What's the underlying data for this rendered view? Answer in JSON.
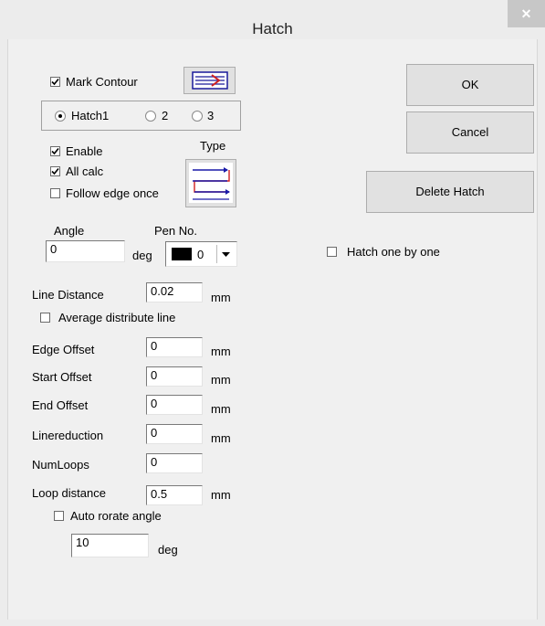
{
  "window": {
    "title": "Hatch",
    "close_glyph": "✕"
  },
  "contour": {
    "mark_label": "Mark Contour",
    "mark_checked": true
  },
  "hatch_select": {
    "options": [
      "Hatch1",
      "2",
      "3"
    ],
    "selected": "Hatch1"
  },
  "hatch": {
    "enable_label": "Enable",
    "enable_checked": true,
    "allcalc_label": "All calc",
    "allcalc_checked": true,
    "follow_label": "Follow edge once",
    "follow_checked": false,
    "type_label": "Type"
  },
  "angle": {
    "label": "Angle",
    "value": "0",
    "unit": "deg"
  },
  "pen": {
    "label": "Pen No.",
    "value": "0",
    "color": "#000000"
  },
  "params": {
    "line_distance": {
      "label": "Line Distance",
      "value": "0.02",
      "unit": "mm"
    },
    "average_label": "Average distribute line",
    "edge_offset": {
      "label": "Edge Offset",
      "value": "0",
      "unit": "mm"
    },
    "start_offset": {
      "label": "Start Offset",
      "value": "0",
      "unit": "mm"
    },
    "end_offset": {
      "label": "End Offset",
      "value": "0",
      "unit": "mm"
    },
    "linereduction": {
      "label": "Linereduction",
      "value": "0",
      "unit": "mm"
    },
    "numloops": {
      "label": "NumLoops",
      "value": "0"
    },
    "loop_distance": {
      "label": "Loop distance",
      "value": "0.5",
      "unit": "mm"
    },
    "auto_rotate_label": "Auto rorate angle",
    "auto_rotate_value": "10",
    "auto_rotate_unit": "deg"
  },
  "buttons": {
    "ok": "OK",
    "cancel": "Cancel",
    "delete": "Delete Hatch"
  },
  "hatch_one_by_one": {
    "label": "Hatch one by one",
    "checked": false
  },
  "colors": {
    "close_bg": "#c7c7c7",
    "window_bg": "#f0f0f0"
  }
}
